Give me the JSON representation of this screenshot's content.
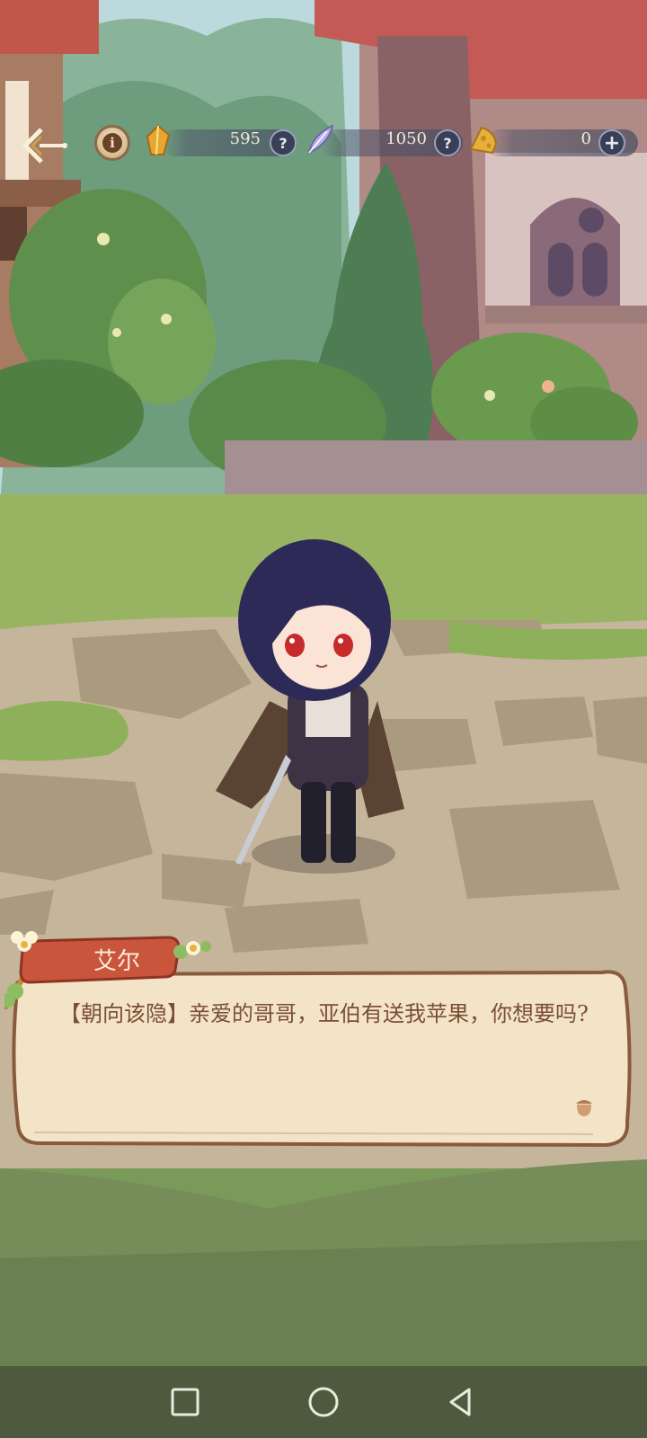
{
  "resources": [
    {
      "name": "crystal",
      "value": "595",
      "icon": "amber-crystal-icon",
      "color": "#e7a631"
    },
    {
      "name": "feather",
      "value": "1050",
      "icon": "feather-quill-icon",
      "color": "#b7b0e8"
    },
    {
      "name": "cheese",
      "value": "0",
      "icon": "cheese-icon",
      "color": "#e8b03a"
    }
  ],
  "dialog": {
    "speaker": "艾尔",
    "text": "【朝向该隐】亲爱的哥哥，亚伯有送我苹果，你想要吗?"
  },
  "hud": {
    "info_glyph": "i",
    "help_glyph": "?",
    "add_glyph": "+"
  },
  "colors": {
    "grass": "#8fb05a",
    "stone": "#bfae93",
    "name_plate": "#c8553c",
    "dialog_bg": "#f3e4c8",
    "dialog_border": "#8a5a3c"
  }
}
